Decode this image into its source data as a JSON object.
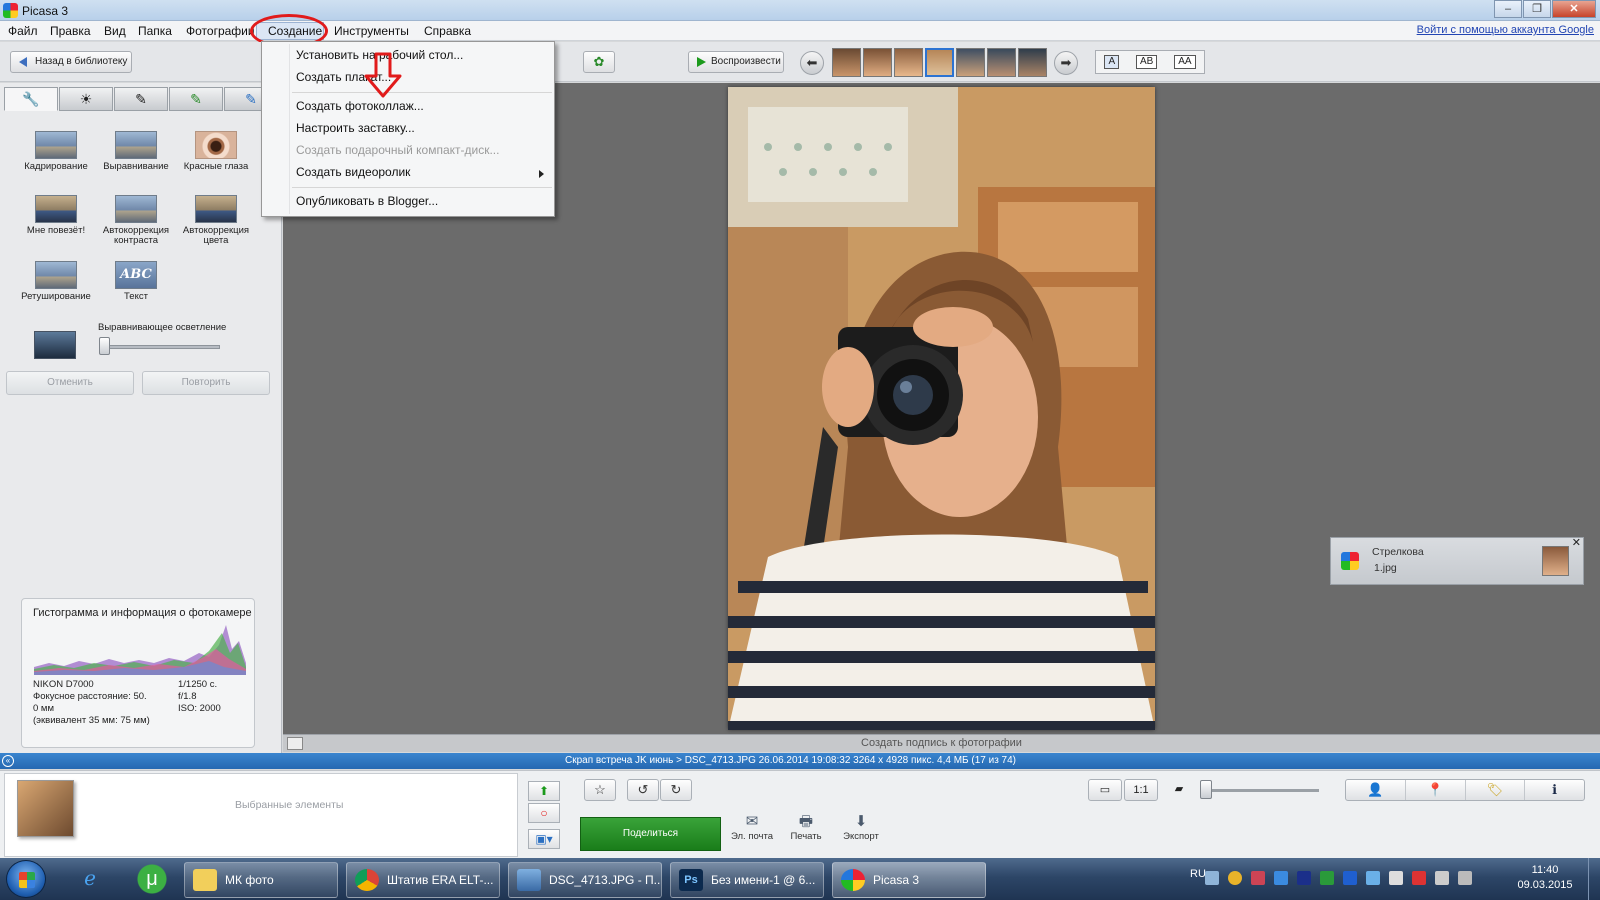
{
  "window": {
    "title": "Picasa 3",
    "google_link": "Войти с помощью аккаунта Google",
    "min": "–",
    "max": "❐",
    "close": "✕"
  },
  "menu": [
    "Файл",
    "Правка",
    "Вид",
    "Папка",
    "Фотографии",
    "Создание",
    "Инструменты",
    "Справка"
  ],
  "dropdown": {
    "items": [
      {
        "label": "Установить на рабочий стол...",
        "enabled": true
      },
      {
        "label": "Создать плакат...",
        "enabled": true
      },
      {
        "label": "Создать фотоколлаж...",
        "enabled": true
      },
      {
        "label": "Настроить заставку...",
        "enabled": true
      },
      {
        "label": "Создать подарочный компакт-диск...",
        "enabled": false
      },
      {
        "label": "Создать видеоролик",
        "enabled": true,
        "submenu": true
      },
      {
        "label": "Опубликовать в Blogger...",
        "enabled": true
      }
    ]
  },
  "toolbar": {
    "back_label": "Назад в библиотеку",
    "play_label": "Воспроизвести",
    "caption_modes": [
      "A",
      "AB",
      "AA"
    ]
  },
  "edit_panel": {
    "tab_icons": [
      "wrench-icon",
      "sun-icon",
      "brush-icon",
      "brush-green-icon",
      "brush-blue-icon"
    ],
    "tools": [
      {
        "label": "Кадрирование",
        "icon": "crop-icon"
      },
      {
        "label": "Выравнивание",
        "icon": "straighten-icon"
      },
      {
        "label": "Красные глаза",
        "icon": "red-eye-icon"
      },
      {
        "label": "Мне повезёт!",
        "icon": "lucky-icon"
      },
      {
        "label": "Автокоррекция контраста",
        "icon": "auto-contrast-icon"
      },
      {
        "label": "Автокоррекция цвета",
        "icon": "auto-color-icon"
      },
      {
        "label": "Ретуширование",
        "icon": "retouch-icon"
      },
      {
        "label": "Текст",
        "icon": "text-icon"
      }
    ],
    "fill_light_label": "Выравнивающее осветление",
    "fill_light_value": 0,
    "undo_label": "Отменить",
    "redo_label": "Повторить"
  },
  "histogram": {
    "title": "Гистограмма и информация о фотокамере",
    "camera": "NIKON D7000",
    "focal": "Фокусное расстояние: 50.",
    "focal2": "0 мм",
    "equiv": "(эквивалент 35 мм:  75 мм)",
    "exposure": "1/1250 с.",
    "aperture": "f/1.8",
    "iso": "ISO: 2000"
  },
  "caption_placeholder": "Создать подпись к фотографии",
  "status": {
    "text": "Скрап встреча JK июнь > DSC_4713.JPG     26.06.2014 19:08:32     3264 x 4928 пикс.     4,4 МБ     (17 из 74)",
    "collapse": "«"
  },
  "notification": {
    "line1": "Стрелкова",
    "line2": "1.jpg",
    "close": "✕"
  },
  "tray": {
    "selected_label": "Выбранные элементы",
    "share_label": "Поделиться",
    "actions": [
      {
        "label": "Эл. почта",
        "icon": "✉"
      },
      {
        "label": "Печать",
        "icon": "🖶"
      },
      {
        "label": "Экспорт",
        "icon": "⬇"
      }
    ],
    "right_tools": [
      "person-icon",
      "location-icon",
      "tag-icon",
      "info-icon"
    ],
    "zoom_level": 0.0
  },
  "taskbar": {
    "tasks": [
      "МК фото",
      "Штатив ERA ELT-...",
      "DSC_4713.JPG - П...",
      "Без имени-1 @ 6...",
      "Picasa 3"
    ],
    "lang": "RU",
    "time": "11:40",
    "date": "09.03.2015"
  },
  "colors": {
    "status_blue": "#2a72bf",
    "share_green": "#238a23",
    "highlight_red": "#e11b1b"
  }
}
